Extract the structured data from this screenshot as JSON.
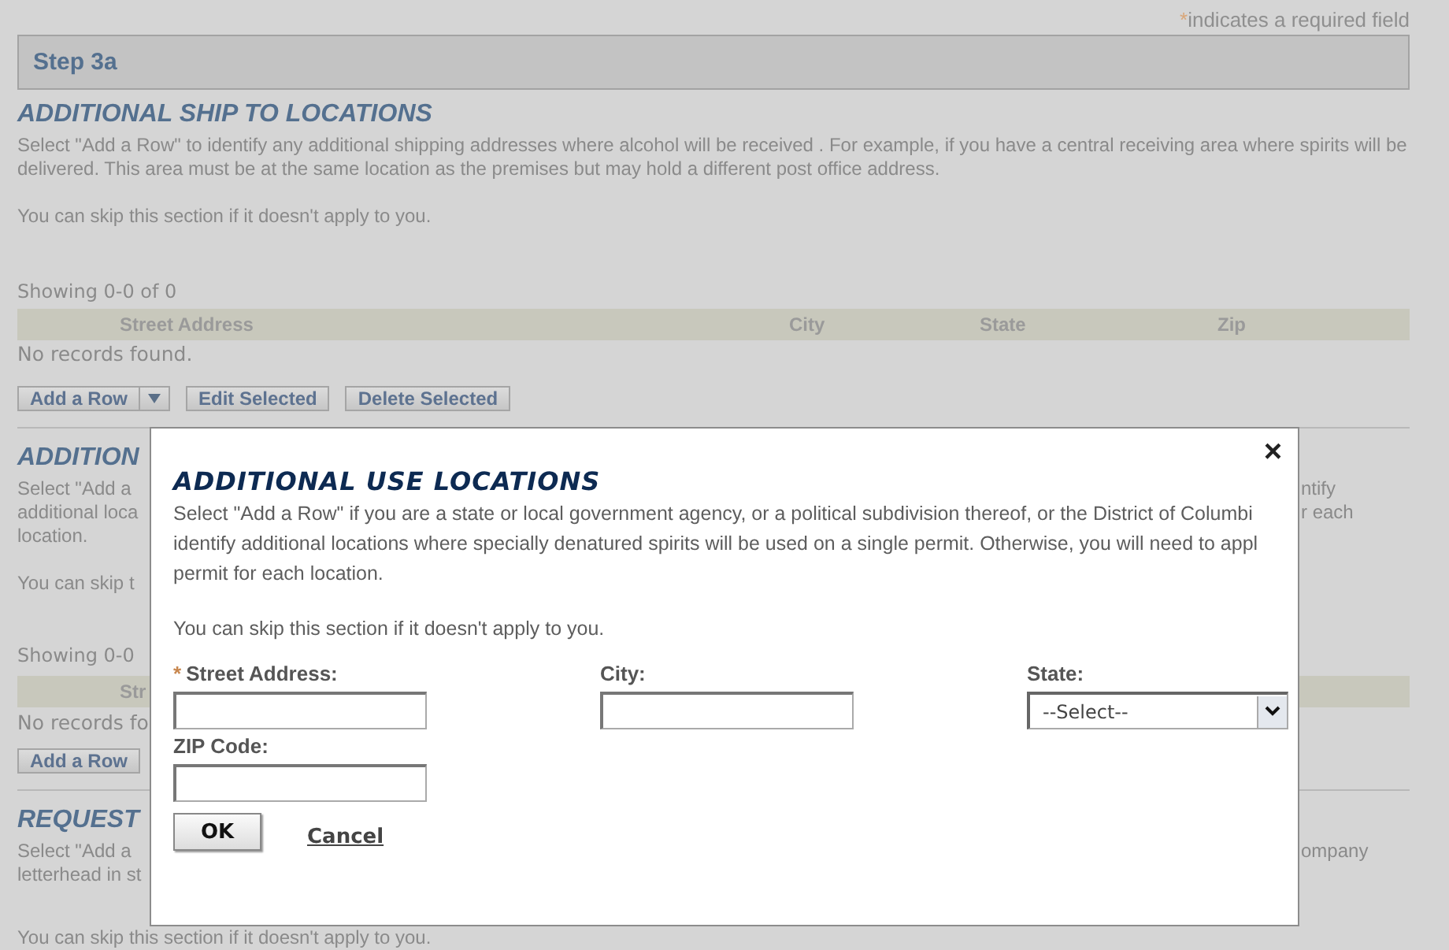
{
  "required_note": {
    "mark": "*",
    "text": "indicates a required field"
  },
  "step": "Step 3a",
  "section": {
    "title": "ADDITIONAL SHIP TO LOCATIONS",
    "paragraphs": [
      "Select \"Add a Row\" to identify any additional shipping addresses where alcohol will be received . For example, if you have a central receiving area where spirits will be delivered. This area must be at the same location as the premises but may hold a different post office address.",
      "You can skip this section if it doesn't apply to you."
    ],
    "showing": "Showing 0-0 of 0",
    "columns": [
      "Street Address",
      "City",
      "State",
      "Zip"
    ],
    "empty": "No records found.",
    "buttons": [
      {
        "label": "Add a Row",
        "kind": "split"
      },
      {
        "label": "Edit Selected",
        "kind": "plain"
      },
      {
        "label": "Delete Selected",
        "kind": "plain"
      }
    ]
  },
  "covered_sections": [
    [
      {
        "kind": "title",
        "left": "ADDITION"
      },
      {
        "kind": "text",
        "left": "Select \"Add a",
        "right": "ntify"
      },
      {
        "kind": "text",
        "left": "additional loca",
        "right": "r each"
      },
      {
        "kind": "text",
        "left": "location."
      },
      {
        "kind": "gap"
      },
      {
        "kind": "text",
        "left": "You can skip t"
      },
      {
        "kind": "gap"
      },
      {
        "kind": "gap"
      },
      {
        "kind": "showing",
        "left": "Showing 0-0"
      },
      {
        "kind": "header",
        "left": "Str"
      },
      {
        "kind": "empty",
        "left": "No records fo"
      },
      {
        "kind": "button",
        "left": "Add a Row"
      }
    ],
    [
      {
        "kind": "title",
        "left": "REQUEST"
      },
      {
        "kind": "text",
        "left": "Select \"Add a",
        "right": "ompany"
      },
      {
        "kind": "text",
        "left": "letterhead in st"
      },
      {
        "kind": "gap"
      },
      {
        "kind": "text",
        "left": "You can skip this section if it doesn't apply to you."
      }
    ]
  ],
  "modal": {
    "close": "×",
    "title": "ADDITIONAL USE LOCATIONS",
    "lines": [
      "Select \"Add a Row\" if you are a state or local government agency, or a political subdivision thereof, or the District of Columbi",
      "identify additional locations where specially denatured spirits will be used on a single permit. Otherwise, you will need to appl",
      "permit for each location."
    ],
    "skip": "You can skip this section if it doesn't apply to you.",
    "fields": [
      {
        "label": "Street Address:",
        "required": true,
        "kind": "text"
      },
      {
        "label": "City:",
        "required": false,
        "kind": "text"
      },
      {
        "label": "State:",
        "required": false,
        "kind": "select",
        "value": "--Select--"
      },
      {
        "label": "ZIP Code:",
        "required": false,
        "kind": "text"
      }
    ],
    "ok": "OK",
    "cancel": "Cancel"
  }
}
